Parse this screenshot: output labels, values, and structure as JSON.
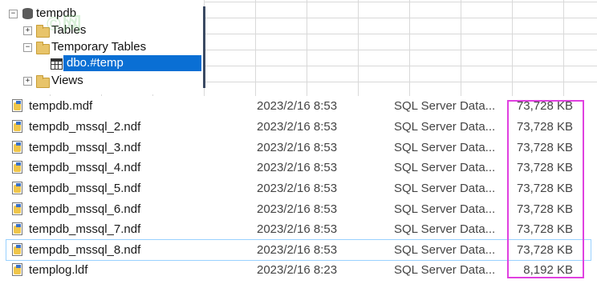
{
  "tree": {
    "root": {
      "label": "tempdb",
      "expander": "−"
    },
    "nodes": [
      {
        "label": "Tables",
        "expander": "+"
      },
      {
        "label": "Temporary Tables",
        "expander": "−"
      },
      {
        "label": "dbo.#temp",
        "selected": true
      },
      {
        "label": "Views",
        "expander": "+"
      }
    ]
  },
  "watermark": "©网",
  "files": [
    {
      "name": "tempdb.mdf",
      "date": "2023/2/16 8:53",
      "type": "SQL Server Data...",
      "size": "73,728 KB"
    },
    {
      "name": "tempdb_mssql_2.ndf",
      "date": "2023/2/16 8:53",
      "type": "SQL Server Data...",
      "size": "73,728 KB"
    },
    {
      "name": "tempdb_mssql_3.ndf",
      "date": "2023/2/16 8:53",
      "type": "SQL Server Data...",
      "size": "73,728 KB"
    },
    {
      "name": "tempdb_mssql_4.ndf",
      "date": "2023/2/16 8:53",
      "type": "SQL Server Data...",
      "size": "73,728 KB"
    },
    {
      "name": "tempdb_mssql_5.ndf",
      "date": "2023/2/16 8:53",
      "type": "SQL Server Data...",
      "size": "73,728 KB"
    },
    {
      "name": "tempdb_mssql_6.ndf",
      "date": "2023/2/16 8:53",
      "type": "SQL Server Data...",
      "size": "73,728 KB"
    },
    {
      "name": "tempdb_mssql_7.ndf",
      "date": "2023/2/16 8:53",
      "type": "SQL Server Data...",
      "size": "73,728 KB"
    },
    {
      "name": "tempdb_mssql_8.ndf",
      "date": "2023/2/16 8:53",
      "type": "SQL Server Data...",
      "size": "73,728 KB",
      "highlighted": true
    },
    {
      "name": "templog.ldf",
      "date": "2023/2/16 8:23",
      "type": "SQL Server Data...",
      "size": "8,192 KB"
    }
  ],
  "colors": {
    "selection": "#0a6fd4",
    "annotation_box": "#e040e0",
    "row_highlight": "#99d1ff"
  }
}
